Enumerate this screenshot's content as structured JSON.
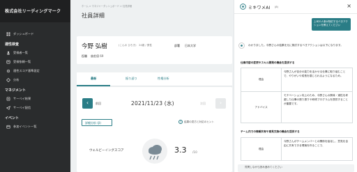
{
  "sidebar": {
    "brand": "株式会社リーディングマーク",
    "items": [
      {
        "type": "item",
        "label": "ダッシュボード",
        "icon": "dashboard-icon"
      },
      {
        "type": "section",
        "label": "適性検査"
      },
      {
        "type": "item",
        "label": "受検者一覧",
        "icon": "users-icon"
      },
      {
        "type": "item",
        "label": "受検依頼一覧",
        "icon": "request-icon"
      },
      {
        "type": "item",
        "label": "適性スコア基準設定",
        "icon": "settings-icon"
      },
      {
        "type": "item",
        "label": "分析",
        "icon": "analysis-icon"
      },
      {
        "type": "section",
        "label": "マネジメント"
      },
      {
        "type": "item",
        "label": "サーベイ結果",
        "icon": "survey-result-icon"
      },
      {
        "type": "item",
        "label": "サーベイ配信",
        "icon": "survey-send-icon"
      },
      {
        "type": "section",
        "label": "イベント"
      },
      {
        "type": "item",
        "label": "参加イベント一覧",
        "icon": "event-icon"
      }
    ]
  },
  "main": {
    "breadcrumb": "ホーム > マネジャーダッシュボード > 社員詳細",
    "title": "社員詳細",
    "person": {
      "name": "今野 弘樹",
      "kana": "(こんの ひろき)　24歳 / 男性",
      "dept_label": "部署",
      "dept_value": "日本大学",
      "position_label": "役職",
      "position_value": "偏差値 69"
    },
    "tabs": [
      "最新",
      "振り返り",
      "性格分析"
    ],
    "date_nav": {
      "prev_label": "前回",
      "date": "2021/11/23 (水)",
      "next_label": "次回"
    },
    "filter_button": "詳細分析 (β)",
    "hint": "結果の見方と対応のヒント",
    "score_label": "ウェルビーイングスコア",
    "score_value": "3.3",
    "score_max": "/10"
  },
  "chat": {
    "title": "ミキワメAI",
    "beta": "(β)",
    "close": "×",
    "user_message": "上司や人事が検討するべきアクションを教えてください",
    "bot_intro": "わかりました。今野さんの結果を元に検討するべきアクションは以下になります。",
    "section1_title": "仕事内容の変更やスキル開発の機会を提供する",
    "section1_rows": [
      {
        "label": "理由",
        "text": "今野さんが自分の能力を活かせる仕事に取り組むことで、やりがいや成長を感じられるようになるため。"
      },
      {
        "label": "アドバイス",
        "text": "モチベーション向上のため、今野さんの興味・適性を考慮した仕事の割り振りや研修プログラムを提供することが重要です。"
      }
    ],
    "section2_title": "チーム内での情報共有や意見交換の機会を提供する",
    "section2_rows": [
      {
        "label": "理由",
        "text": "今野さんがチームメンバーとの関係を強化し、意見を自由に共有できる環境を作ることで、"
      }
    ],
    "input_placeholder": "質問しながら読み進めてください"
  },
  "colors": {
    "accent": "#2a7d86",
    "sidebar_bg": "#2a2c2d"
  }
}
